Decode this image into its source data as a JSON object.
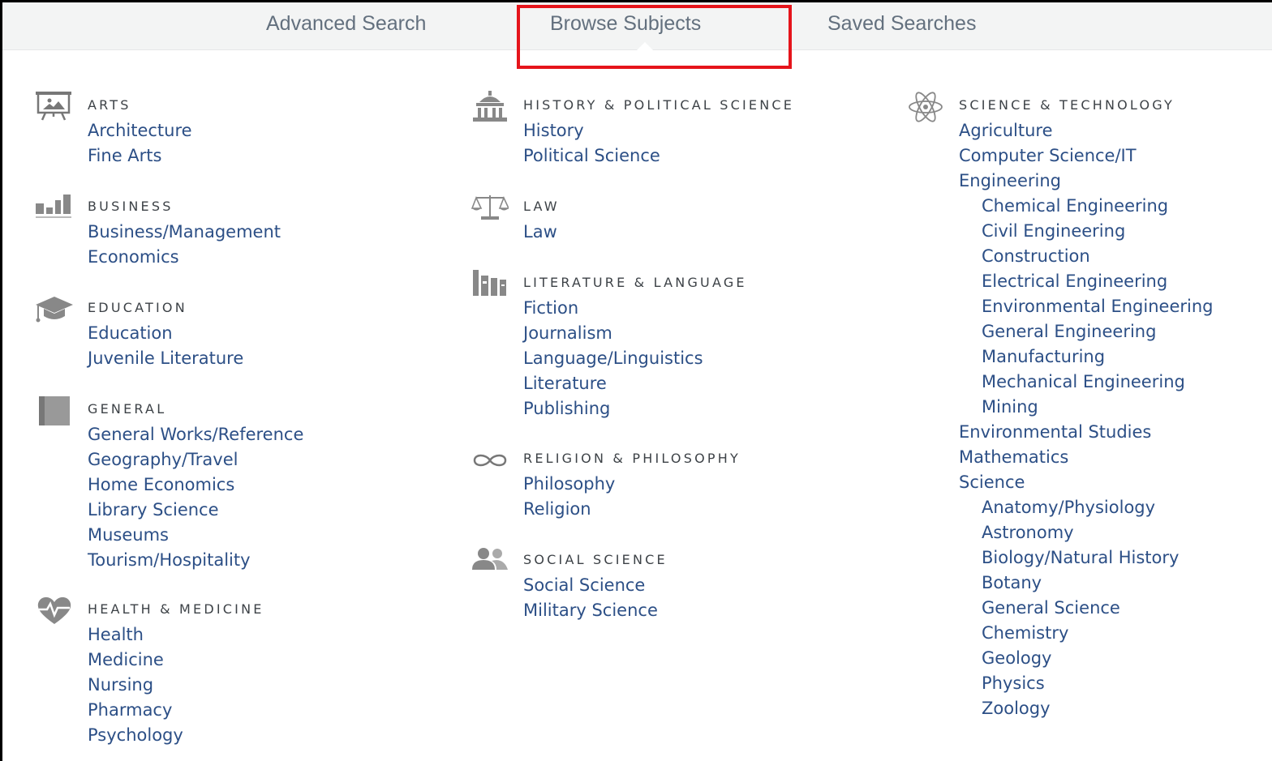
{
  "tabs": {
    "advanced": "Advanced Search",
    "browse": "Browse Subjects",
    "saved": "Saved Searches"
  },
  "columns": [
    [
      {
        "heading": "ARTS",
        "icon": "easel-picture-icon",
        "items": [
          {
            "label": "Architecture"
          },
          {
            "label": "Fine Arts"
          }
        ]
      },
      {
        "heading": "BUSINESS",
        "icon": "bar-chart-icon",
        "items": [
          {
            "label": "Business/Management"
          },
          {
            "label": "Economics"
          }
        ]
      },
      {
        "heading": "EDUCATION",
        "icon": "graduation-cap-icon",
        "items": [
          {
            "label": "Education"
          },
          {
            "label": "Juvenile Literature"
          }
        ]
      },
      {
        "heading": "GENERAL",
        "icon": "book-icon",
        "items": [
          {
            "label": "General Works/Reference"
          },
          {
            "label": "Geography/Travel"
          },
          {
            "label": "Home Economics"
          },
          {
            "label": "Library Science"
          },
          {
            "label": "Museums"
          },
          {
            "label": "Tourism/Hospitality"
          }
        ]
      },
      {
        "heading": "HEALTH & MEDICINE",
        "icon": "heart-pulse-icon",
        "items": [
          {
            "label": "Health"
          },
          {
            "label": "Medicine"
          },
          {
            "label": "Nursing"
          },
          {
            "label": "Pharmacy"
          },
          {
            "label": "Psychology"
          }
        ]
      }
    ],
    [
      {
        "heading": "HISTORY & POLITICAL SCIENCE",
        "icon": "capitol-building-icon",
        "items": [
          {
            "label": "History"
          },
          {
            "label": "Political Science"
          }
        ]
      },
      {
        "heading": "LAW",
        "icon": "scales-icon",
        "items": [
          {
            "label": "Law"
          }
        ]
      },
      {
        "heading": "LITERATURE & LANGUAGE",
        "icon": "books-icon",
        "items": [
          {
            "label": "Fiction"
          },
          {
            "label": "Journalism"
          },
          {
            "label": "Language/Linguistics"
          },
          {
            "label": "Literature"
          },
          {
            "label": "Publishing"
          }
        ]
      },
      {
        "heading": "RELIGION & PHILOSOPHY",
        "icon": "infinity-icon",
        "items": [
          {
            "label": "Philosophy"
          },
          {
            "label": "Religion"
          }
        ]
      },
      {
        "heading": "SOCIAL SCIENCE",
        "icon": "people-icon",
        "items": [
          {
            "label": "Social Science"
          },
          {
            "label": "Military Science"
          }
        ]
      }
    ],
    [
      {
        "heading": "SCIENCE & TECHNOLOGY",
        "icon": "atom-icon",
        "items": [
          {
            "label": "Agriculture"
          },
          {
            "label": "Computer Science/IT"
          },
          {
            "label": "Engineering"
          },
          {
            "label": "Chemical Engineering",
            "sub": true
          },
          {
            "label": "Civil Engineering",
            "sub": true
          },
          {
            "label": "Construction",
            "sub": true
          },
          {
            "label": "Electrical Engineering",
            "sub": true
          },
          {
            "label": "Environmental Engineering",
            "sub": true
          },
          {
            "label": "General Engineering",
            "sub": true
          },
          {
            "label": "Manufacturing",
            "sub": true
          },
          {
            "label": "Mechanical Engineering",
            "sub": true
          },
          {
            "label": "Mining",
            "sub": true
          },
          {
            "label": "Environmental Studies"
          },
          {
            "label": "Mathematics"
          },
          {
            "label": "Science"
          },
          {
            "label": "Anatomy/Physiology",
            "sub": true
          },
          {
            "label": "Astronomy",
            "sub": true
          },
          {
            "label": "Biology/Natural History",
            "sub": true
          },
          {
            "label": "Botany",
            "sub": true
          },
          {
            "label": "General Science",
            "sub": true
          },
          {
            "label": "Chemistry",
            "sub": true
          },
          {
            "label": "Geology",
            "sub": true
          },
          {
            "label": "Physics",
            "sub": true
          },
          {
            "label": "Zoology",
            "sub": true
          }
        ]
      }
    ]
  ]
}
